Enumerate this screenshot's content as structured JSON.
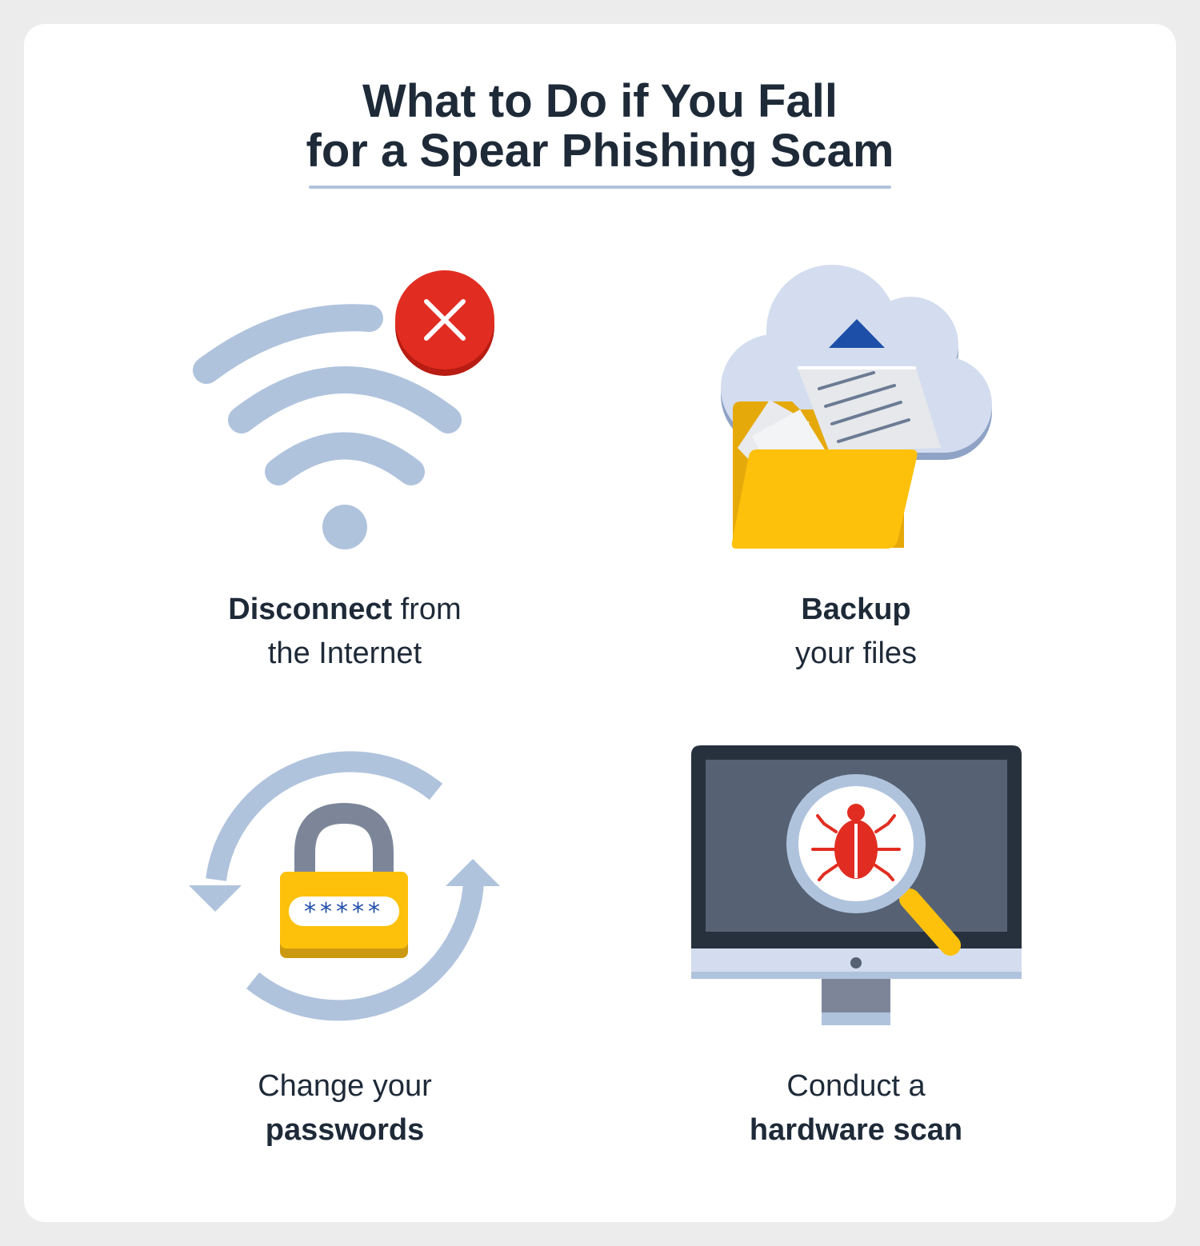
{
  "title": {
    "line1": "What to Do if You Fall",
    "line2": "for a Spear Phishing Scam"
  },
  "steps": [
    {
      "bold": "Disconnect",
      "rest": " from",
      "line2": "the Internet",
      "icon": "wifi-disconnected-icon"
    },
    {
      "bold": "Backup",
      "line2": "your files",
      "icon": "cloud-backup-folder-icon"
    },
    {
      "line1": "Change your",
      "bold": "passwords",
      "icon": "padlock-refresh-icon",
      "password_mask": "*****"
    },
    {
      "line1": "Conduct a",
      "bold": "hardware scan",
      "icon": "monitor-bug-scan-icon"
    }
  ],
  "colors": {
    "title": "#1e2a38",
    "light_blue": "#b0c3dd",
    "red": "#e12d21",
    "yellow": "#fdc10c",
    "dark_blue": "#1e4fa8",
    "monitor_dark": "#27313e",
    "monitor_screen": "#566274"
  }
}
